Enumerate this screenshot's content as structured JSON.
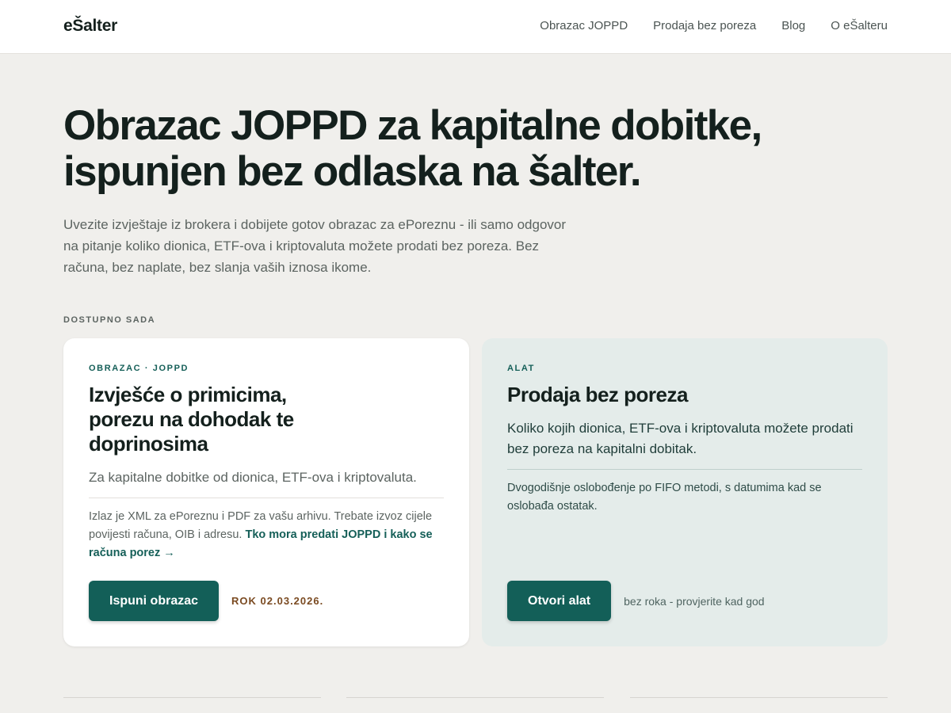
{
  "header": {
    "logo": "eŠalter",
    "nav": [
      {
        "label": "Obrazac JOPPD"
      },
      {
        "label": "Prodaja bez poreza"
      },
      {
        "label": "Blog"
      },
      {
        "label": "O eŠalteru"
      }
    ]
  },
  "hero": {
    "title_line1": "Obrazac JOPPD za kapitalne dobitke,",
    "title_line2": "ispunjen bez odlaska na šalter.",
    "subtitle": "Uvezite izvještaje iz brokera i dobijete gotov obrazac za ePoreznu - ili samo odgovor na pitanje koliko dionica, ETF-ova i kriptovaluta možete prodati bez poreza. Bez računa, bez naplate, bez slanja vaših iznosa ikome."
  },
  "section_label": "DOSTUPNO SADA",
  "cards": [
    {
      "eyebrow": "OBRAZAC · JOPPD",
      "title": "Izvješće o primicima, porezu na dohodak te doprinosima",
      "lead": "Za kapitalne dobitke od dionica, ETF-ova i kriptovaluta.",
      "note": "Izlaz je XML za ePoreznu i PDF za vašu arhivu. Trebate izvoz cijele povijesti računa, OIB i adresu.",
      "link": "Tko mora predati JOPPD i kako se računa porez →",
      "button": "Ispuni obrazac",
      "status": "ROK 02.03.2026."
    },
    {
      "eyebrow": "ALAT",
      "title": "Prodaja bez poreza",
      "lead": "Koliko kojih dionica, ETF-ova i kriptovaluta možete prodati bez poreza na kapitalni dobitak.",
      "note": "Dvogodišnje oslobođenje po FIFO metodi, s datumima kad se oslobađa ostatak.",
      "button": "Otvori alat",
      "status": "bez roka - provjerite kad god"
    }
  ],
  "colors": {
    "accent": "#135f58",
    "background": "#f0efec",
    "deadline": "#7a4a21"
  }
}
